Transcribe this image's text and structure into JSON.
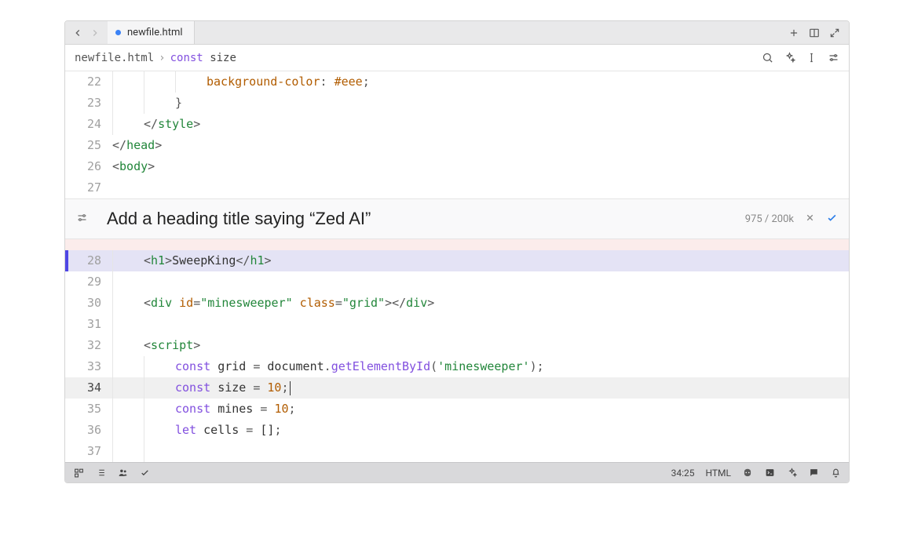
{
  "tab": {
    "filename": "newfile.html",
    "modified": true
  },
  "breadcrumb": {
    "file": "newfile.html",
    "kw": "const",
    "ident": "size"
  },
  "ai_prompt": {
    "text": "Add a heading title saying “Zed AI”",
    "count": "975 / 200k"
  },
  "status": {
    "cursor": "34:25",
    "language": "HTML"
  },
  "lines": {
    "l22": {
      "num": "22",
      "cssprop": "background-color",
      "colon": ": ",
      "cssval": "#eee",
      "semi": ";"
    },
    "l23": {
      "num": "23",
      "brace": "}"
    },
    "l24": {
      "num": "24",
      "open": "</",
      "tag": "style",
      "close": ">"
    },
    "l25": {
      "num": "25",
      "open": "</",
      "tag": "head",
      "close": ">"
    },
    "l26": {
      "num": "26",
      "open": "<",
      "tag": "body",
      "close": ">"
    },
    "l27": {
      "num": "27"
    },
    "l28": {
      "num": "28",
      "o1": "<",
      "t1": "h1",
      "c1": ">",
      "text": "SweepKing",
      "o2": "</",
      "t2": "h1",
      "c2": ">"
    },
    "l29": {
      "num": "29"
    },
    "l30": {
      "num": "30",
      "o1": "<",
      "t1": "div",
      "a1": " id",
      "eq1": "=",
      "s1": "\"minesweeper\"",
      "a2": " class",
      "eq2": "=",
      "s2": "\"grid\"",
      "c1": ">",
      "o2": "</",
      "t2": "div",
      "c2": ">"
    },
    "l31": {
      "num": "31"
    },
    "l32": {
      "num": "32",
      "o1": "<",
      "t1": "script",
      "c1": ">"
    },
    "l33": {
      "num": "33",
      "kw": "const",
      "sp": " ",
      "id": "grid",
      "op": " = ",
      "obj": "document",
      "dot": ".",
      "fn": "getElementById",
      "lp": "(",
      "arg": "'minesweeper'",
      "rp": ")",
      "semi": ";"
    },
    "l34": {
      "num": "34",
      "kw": "const",
      "sp": " ",
      "id": "size",
      "op": " = ",
      "val": "10",
      "semi": ";"
    },
    "l35": {
      "num": "35",
      "kw": "const",
      "sp": " ",
      "id": "mines",
      "op": " = ",
      "val": "10",
      "semi": ";"
    },
    "l36": {
      "num": "36",
      "kw": "let",
      "sp": " ",
      "id": "cells",
      "op": " = ",
      "val": "[]",
      "semi": ";"
    },
    "l37": {
      "num": "37"
    }
  }
}
